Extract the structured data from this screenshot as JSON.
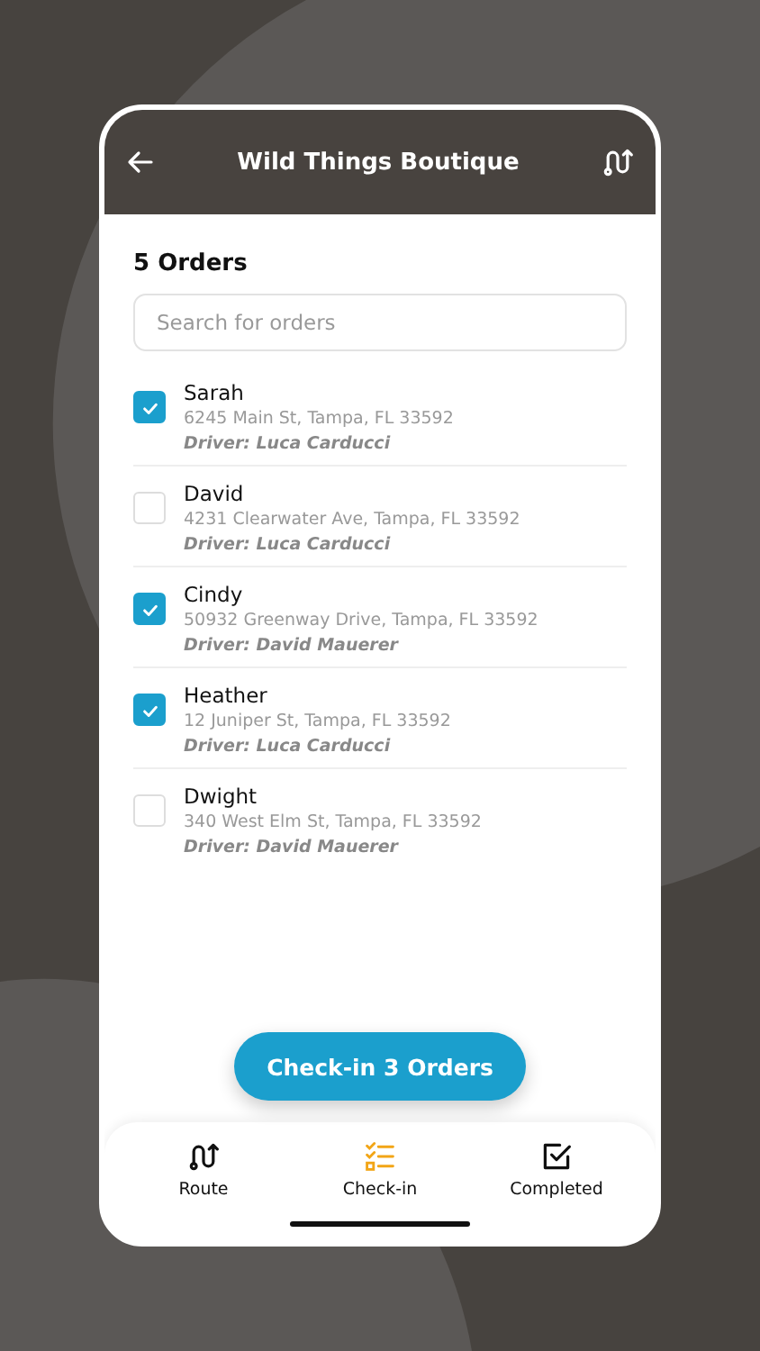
{
  "header": {
    "title": "Wild Things Boutique"
  },
  "orders_count": "5 Orders",
  "search": {
    "placeholder": "Search for orders"
  },
  "orders": [
    {
      "name": "Sarah",
      "address": "6245 Main St, Tampa, FL 33592",
      "driver": "Driver: Luca Carducci",
      "checked": true
    },
    {
      "name": "David",
      "address": "4231 Clearwater Ave, Tampa, FL 33592",
      "driver": "Driver: Luca Carducci",
      "checked": false
    },
    {
      "name": "Cindy",
      "address": "50932 Greenway Drive, Tampa, FL 33592",
      "driver": "Driver: David Mauerer",
      "checked": true
    },
    {
      "name": "Heather",
      "address": "12 Juniper St, Tampa, FL 33592",
      "driver": "Driver: Luca Carducci",
      "checked": true
    },
    {
      "name": "Dwight",
      "address": "340 West Elm St, Tampa, FL 33592",
      "driver": "Driver: David Mauerer",
      "checked": false
    }
  ],
  "action_button": "Check-in 3 Orders",
  "tabs": [
    {
      "label": "Route",
      "selected": false
    },
    {
      "label": "Check-in",
      "selected": true
    },
    {
      "label": "Completed",
      "selected": false
    }
  ]
}
